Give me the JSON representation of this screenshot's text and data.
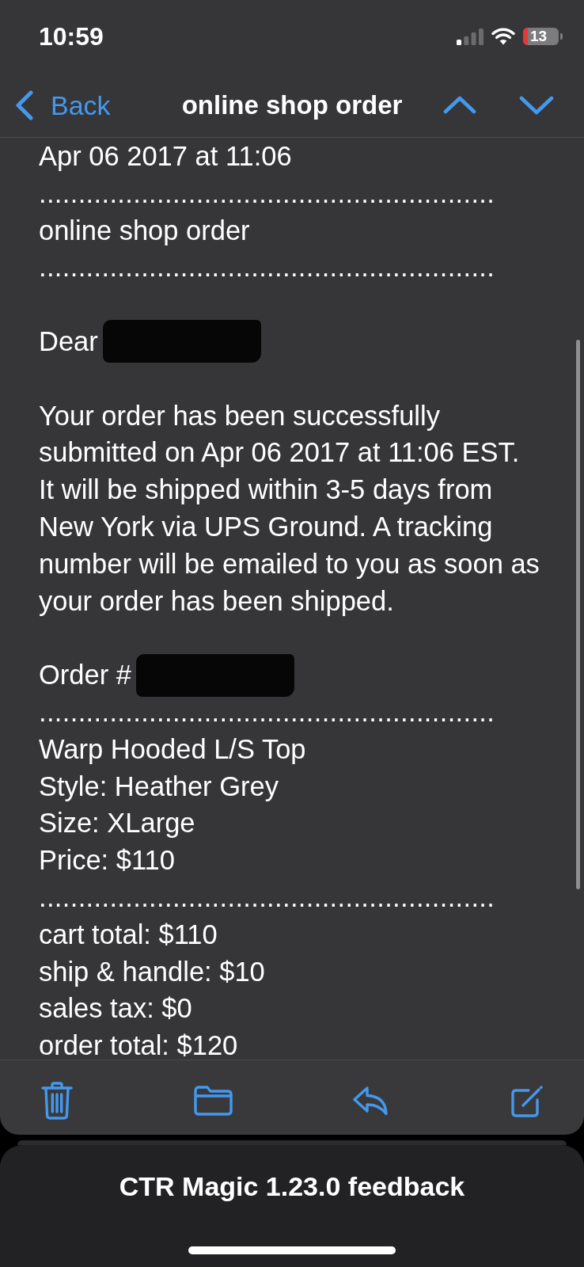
{
  "status_bar": {
    "time": "10:59",
    "battery": "13"
  },
  "nav_bar": {
    "back_label": "Back",
    "title": "online shop order"
  },
  "message": {
    "blocks": [
      {
        "kind": "lines",
        "lines": [
          {
            "kind": "text",
            "text": "Apr 06 2017 at 11:06",
            "redacted": false
          },
          {
            "kind": "separator",
            "text": "..........................................................",
            "redacted": false
          },
          {
            "kind": "text",
            "text": "online shop order",
            "redacted": false
          },
          {
            "kind": "separator",
            "text": "..........................................................",
            "redacted": false
          }
        ]
      },
      {
        "kind": "lines",
        "lines": [
          {
            "kind": "text",
            "text": "Dear",
            "redacted": true
          }
        ]
      },
      {
        "kind": "paragraph",
        "lines": [
          "Your order has been successfully",
          "submitted on Apr 06 2017 at 11:06 EST.",
          "It will be shipped within 3-5 days from",
          "New York via UPS Ground. A tracking",
          "number will be emailed to you as soon as",
          "your order has been shipped."
        ]
      },
      {
        "kind": "lines",
        "lines": [
          {
            "kind": "text",
            "text": "Order #",
            "redacted": true
          },
          {
            "kind": "separator",
            "text": "..........................................................",
            "redacted": false
          },
          {
            "kind": "text",
            "text": "Warp Hooded L/S Top",
            "redacted": false
          },
          {
            "kind": "text",
            "text": "Style: Heather Grey",
            "redacted": false
          },
          {
            "kind": "text",
            "text": "Size: XLarge",
            "redacted": false
          },
          {
            "kind": "text",
            "text": "Price: $110",
            "redacted": false
          },
          {
            "kind": "separator",
            "text": "..........................................................",
            "redacted": false
          },
          {
            "kind": "text",
            "text": "cart total: $110",
            "redacted": false
          },
          {
            "kind": "text",
            "text": "ship & handle: $10",
            "redacted": false
          },
          {
            "kind": "text",
            "text": "sales tax: $0",
            "redacted": false
          },
          {
            "kind": "text",
            "text": "order total: $120",
            "redacted": false
          }
        ]
      }
    ]
  },
  "feedback_sheet": {
    "title": "CTR Magic 1.23.0 feedback"
  }
}
